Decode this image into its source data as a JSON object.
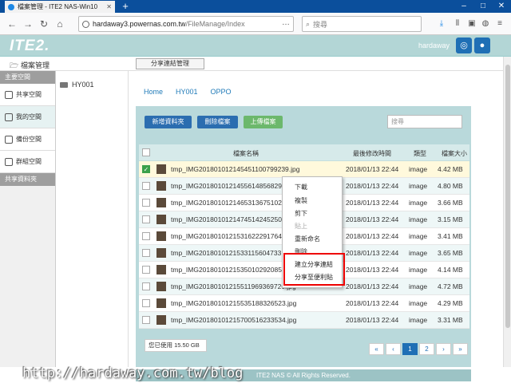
{
  "browser": {
    "tab_title": "檔案管理 - ITE2 NAS-Win10",
    "url_host": "hardaway3.powernas.com.tw",
    "url_path": "/FileManage/Index",
    "url_more": "…",
    "search_placeholder": "搜尋"
  },
  "app": {
    "logo": "ITE2.",
    "username": "hardaway",
    "subtitle": "檔案管理",
    "share_mgmt_label": "分享連結管理"
  },
  "sidebar": {
    "section1": "主要空間",
    "items": [
      {
        "label": "共享空間"
      },
      {
        "label": "我的空間"
      },
      {
        "label": "備份空間"
      },
      {
        "label": "群組空間"
      }
    ],
    "section2": "共享資料夾"
  },
  "tree": {
    "folder": "HY001"
  },
  "breadcrumb": [
    "Home",
    "HY001",
    "OPPO"
  ],
  "actions": {
    "new_folder": "新增資料夾",
    "delete_file": "刪除檔案",
    "upload": "上傳檔案",
    "search_placeholder": "搜尋"
  },
  "table": {
    "headers": {
      "name": "檔案名稱",
      "date": "最後修改時間",
      "type": "類型",
      "size": "檔案大小"
    },
    "rows": [
      {
        "name": "tmp_IMG20180101214545110079923​9.jpg",
        "date": "2018/01/13 22:44",
        "type": "image",
        "size": "4.42 MB"
      },
      {
        "name": "tmp_IMG2018010121455614856829",
        "date": "2018/01/13 22:44",
        "type": "image",
        "size": "4.80 MB"
      },
      {
        "name": "tmp_IMG2018010121465313675102",
        "date": "2018/01/13 22:44",
        "type": "image",
        "size": "3.66 MB"
      },
      {
        "name": "tmp_IMG2018010121474514245250",
        "date": "2018/01/13 22:44",
        "type": "image",
        "size": "3.15 MB"
      },
      {
        "name": "tmp_IMG2018010121531622291764",
        "date": "2018/01/13 22:44",
        "type": "image",
        "size": "3.41 MB"
      },
      {
        "name": "tmp_IMG2018010121533115604733",
        "date": "2018/01/13 22:44",
        "type": "image",
        "size": "3.65 MB"
      },
      {
        "name": "tmp_IMG2018010121535010292085",
        "date": "2018/01/13 22:44",
        "type": "image",
        "size": "4.14 MB"
      },
      {
        "name": "tmp_IMG20180101215511969369720.jpg",
        "date": "2018/01/13 22:44",
        "type": "image",
        "size": "4.72 MB"
      },
      {
        "name": "tmp_IMG20180101215535188326523.jpg",
        "date": "2018/01/13 22:44",
        "type": "image",
        "size": "4.29 MB"
      },
      {
        "name": "tmp_IMG20180101215700516233534.jpg",
        "date": "2018/01/13 22:44",
        "type": "image",
        "size": "3.31 MB"
      }
    ]
  },
  "context_menu": [
    "下載",
    "複製",
    "剪下",
    "貼上",
    "重新命名",
    "刪除",
    "建立分享連結",
    "分享至便利貼"
  ],
  "usage": "您已使用 15.50 GB",
  "pager": {
    "first": "«",
    "prev": "‹",
    "p1": "1",
    "p2": "2",
    "next": "›",
    "last": "»"
  },
  "footer": "ITE2 NAS © All Rights Reserved.",
  "watermark": "http://hardaway.com.tw/blog"
}
